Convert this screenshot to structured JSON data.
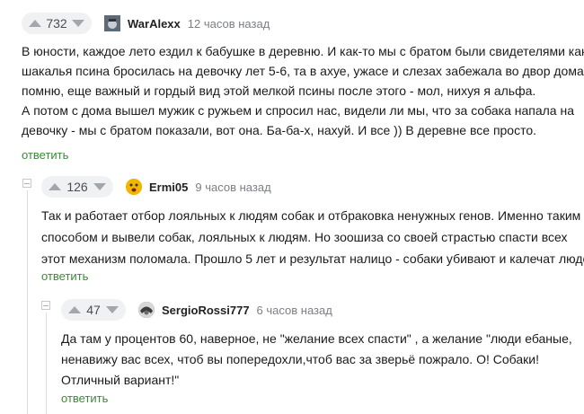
{
  "comments": [
    {
      "rating": "732",
      "nick": "WarAlexx",
      "time": "12 часов назад",
      "avatar_color": "#5d6a78",
      "lines": [
        "В юности, каждое лето ездил к бабушке в деревню. И как-то мы с братом были свидетелями как",
        "шакалья псина бросилась на девочку лет 5-6, та в ахуе, ужасе и слезах забежала во двор дома. И",
        "помню, еще важный и гордый вид этой мелкой псины после этого - мол, нихуя я альфа.",
        "А потом с дома вышел мужик с ружьем и спросил нас, видели ли мы, что за собака напала на",
        "девочку - мы с братом показали, вот она. Ба-ба-х, нахуй. И все )) В деревне все просто."
      ],
      "reply_label": "ответить"
    },
    {
      "rating": "126",
      "nick": "Ermi05",
      "time": "9 часов назад",
      "avatar_color": "#f2b500",
      "lines": [
        "Так и работает отбор лояльных к людям собак и отбраковка ненужных генов. Именно таким",
        "способом и вывели собак, лояльных к людям. Но зоошиза со своей страстью спасти всех",
        "этот механизм поломала. Прошло 5 лет и результат налицо - собаки убивают и калечат людей"
      ],
      "reply_label": "ответить"
    },
    {
      "rating": "47",
      "nick": "SergioRossi777",
      "time": "6 часов назад",
      "avatar_color": "#4a4a4a",
      "lines": [
        "Да там у процентов 60, наверное, не \"желание всех спасти\" , а желание \"люди ебаные,",
        "ненавижу вас всех, чтоб вы попередохли,чтоб вас за зверьё пожрало. О! Собаки!",
        "Отличный вариант!\""
      ],
      "reply_label": "ответить"
    }
  ]
}
